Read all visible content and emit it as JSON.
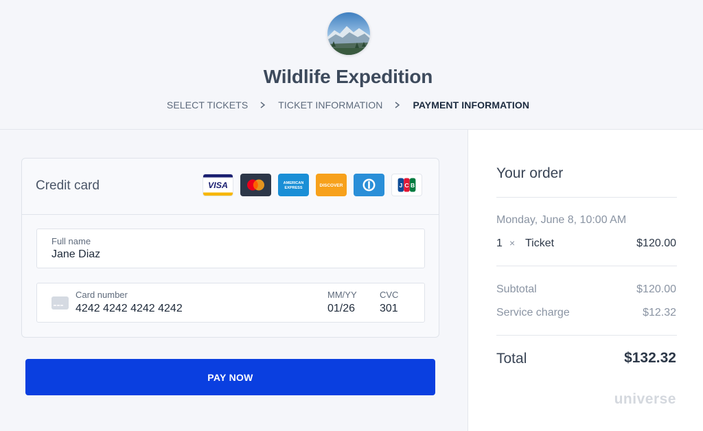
{
  "event": {
    "title": "Wildlife Expedition",
    "image": "mountain-landscape-avatar"
  },
  "breadcrumb": {
    "steps": [
      "SELECT TICKETS",
      "TICKET INFORMATION",
      "PAYMENT INFORMATION"
    ],
    "active_index": 2
  },
  "payment": {
    "section_title": "Credit card",
    "card_brands": {
      "visa": "VISA",
      "mastercard": "mastercard",
      "amex": "AMERICAN EXPRESS",
      "discover": "DISCOVER",
      "diners": "diners",
      "jcb": "JCB"
    },
    "full_name_label": "Full name",
    "full_name_value": "Jane Diaz",
    "card_number_label": "Card number",
    "card_number_value": "4242 4242 4242 4242",
    "expiry_label": "MM/YY",
    "expiry_value": "01/26",
    "cvc_label": "CVC",
    "cvc_value": "301",
    "pay_button": "PAY NOW"
  },
  "order": {
    "title": "Your order",
    "date": "Monday, June 8, 10:00 AM",
    "line_items": [
      {
        "qty": "1",
        "times": "×",
        "name": "Ticket",
        "price": "$120.00"
      }
    ],
    "subtotal_label": "Subtotal",
    "subtotal_value": "$120.00",
    "service_label": "Service charge",
    "service_value": "$12.32",
    "total_label": "Total",
    "total_value": "$132.32",
    "brand": "universe"
  },
  "colors": {
    "primary_button": "#0a3fe0",
    "page_background": "#f5f6fa",
    "panel_background": "#ffffff"
  }
}
